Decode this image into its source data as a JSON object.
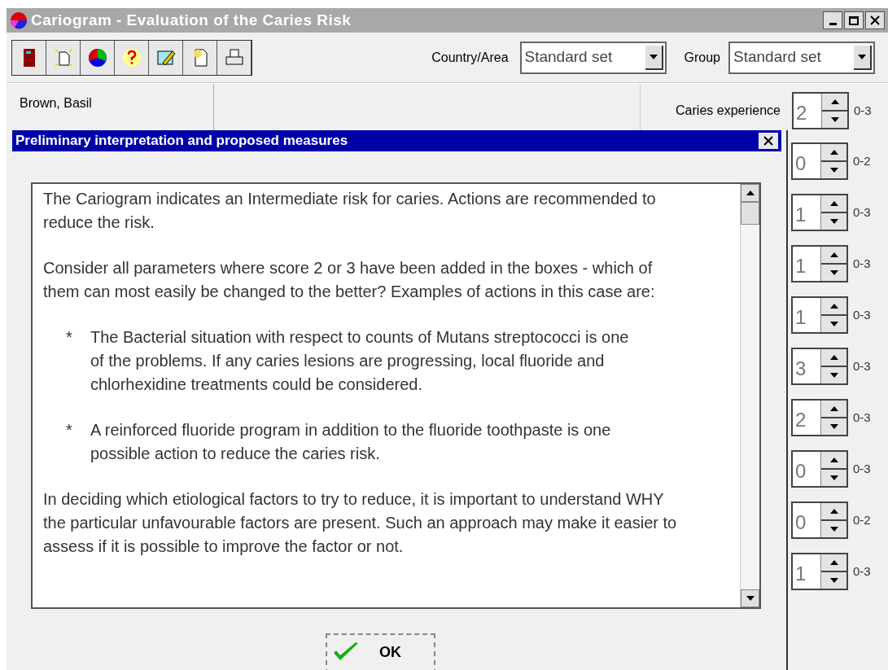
{
  "window": {
    "title": "Cariogram - Evaluation of the Caries Risk"
  },
  "toolbar": {
    "country_label": "Country/Area",
    "country_value": "Standard set",
    "group_label": "Group",
    "group_value": "Standard set"
  },
  "patient": {
    "name": "Brown, Basil"
  },
  "parameters": [
    {
      "label": "Caries experience",
      "value": "2",
      "range": "0-3"
    },
    {
      "value": "0",
      "range": "0-2"
    },
    {
      "value": "1",
      "range": "0-3"
    },
    {
      "value": "1",
      "range": "0-3"
    },
    {
      "value": "1",
      "range": "0-3"
    },
    {
      "value": "3",
      "range": "0-3"
    },
    {
      "value": "2",
      "range": "0-3"
    },
    {
      "value": "0",
      "range": "0-3"
    },
    {
      "value": "0",
      "range": "0-2"
    },
    {
      "value": "1",
      "range": "0-3"
    }
  ],
  "dialog": {
    "title": "Preliminary interpretation and proposed measures",
    "paragraphs": [
      {
        "kind": "para",
        "text": "The Cariogram indicates an Intermediate risk for caries. Actions are recommended to reduce the risk."
      },
      {
        "kind": "para",
        "text": "Consider all parameters where score 2 or 3 have been added in the boxes - which of them can most easily be changed to the better? Examples of actions in this case are:"
      },
      {
        "kind": "bullet",
        "marker": "*",
        "text": "The Bacterial situation with respect to counts of Mutans streptococci is one of the problems. If any caries lesions are progressing, local fluoride and chlorhexidine treatments could be considered."
      },
      {
        "kind": "bullet",
        "marker": "*",
        "text": "A reinforced fluoride program in addition to the fluoride toothpaste is one possible action to reduce the caries risk."
      },
      {
        "kind": "para",
        "text": "In deciding which etiological factors to try to reduce, it is important to understand WHY the particular unfavourable factors are present. Such an approach may make it easier to assess if it is possible to improve the factor or not."
      }
    ],
    "ok": "OK"
  }
}
